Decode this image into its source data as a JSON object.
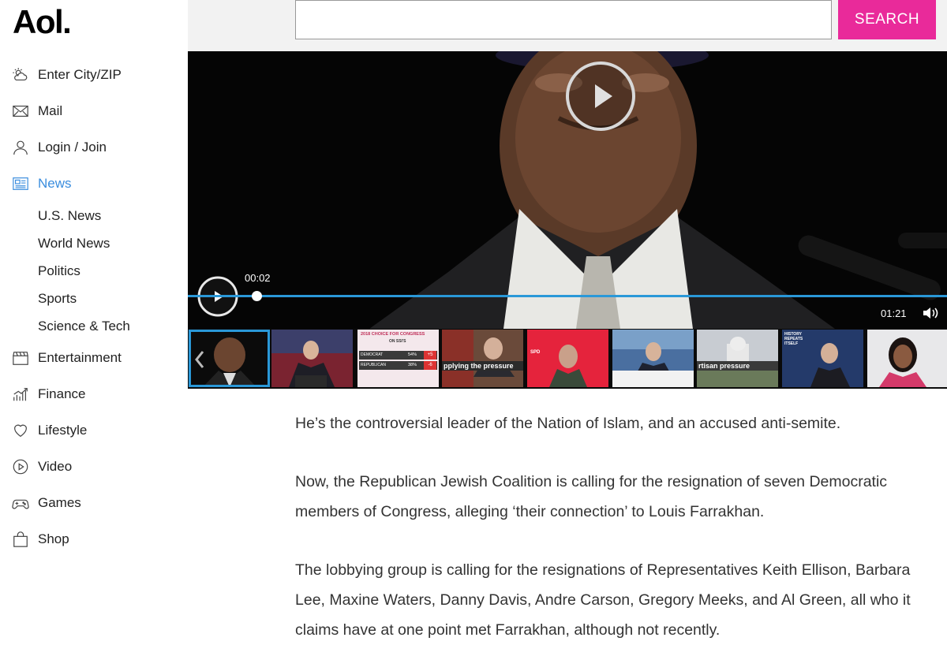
{
  "brand": {
    "logo": "Aol."
  },
  "sidebar": {
    "items": [
      {
        "label": "Enter City/ZIP",
        "icon": "weather-icon"
      },
      {
        "label": "Mail",
        "icon": "mail-icon"
      },
      {
        "label": "Login / Join",
        "icon": "user-icon"
      },
      {
        "label": "News",
        "icon": "news-icon",
        "active": true
      },
      {
        "label": "Entertainment",
        "icon": "clapperboard-icon"
      },
      {
        "label": "Finance",
        "icon": "chart-icon"
      },
      {
        "label": "Lifestyle",
        "icon": "heart-icon"
      },
      {
        "label": "Video",
        "icon": "play-circle-icon"
      },
      {
        "label": "Games",
        "icon": "gamepad-icon"
      },
      {
        "label": "Shop",
        "icon": "shopping-bag-icon"
      }
    ],
    "news_subitems": [
      "U.S. News",
      "World News",
      "Politics",
      "Sports",
      "Science & Tech"
    ]
  },
  "search": {
    "value": "",
    "placeholder": "",
    "button_label": "SEARCH"
  },
  "video": {
    "elapsed": "00:02",
    "duration": "01:21",
    "progress_fraction": 0.025,
    "thumbnails": [
      {
        "title": ""
      },
      {
        "title": ""
      },
      {
        "title": "2018 CHOICE FOR CONGRESS",
        "subtitle": "ON SSI'S",
        "rows": [
          {
            "party": "DEMOCRAT",
            "pct": "54%",
            "change": "+5"
          },
          {
            "party": "REPUBLICAN",
            "pct": "38%",
            "change": "-6"
          }
        ]
      },
      {
        "title": "pplying the pressure"
      },
      {
        "title": "SPD"
      },
      {
        "title": ""
      },
      {
        "title": "rtisan pressure"
      },
      {
        "title": "HISTORY REPEATS ITSELF"
      },
      {
        "title": ""
      }
    ]
  },
  "article": {
    "paragraphs": [
      "He’s the controversial leader of the Nation of Islam, and an accused anti-semite.",
      "Now, the Republican Jewish Coalition is calling for the resignation of seven Democratic members of Congress, alleging ‘their connection’ to Louis Farrakhan.",
      "The lobbying group is calling for the resignations of Representatives Keith Ellison, Barbara Lee, Maxine Waters, Danny Davis, Andre Carson, Gregory Meeks, and Al Green, all who it claims have at one point met Farrakhan, although not recently."
    ]
  },
  "colors": {
    "accent": "#e92a9a",
    "link": "#3a8dde",
    "progress": "#2a98d8"
  }
}
